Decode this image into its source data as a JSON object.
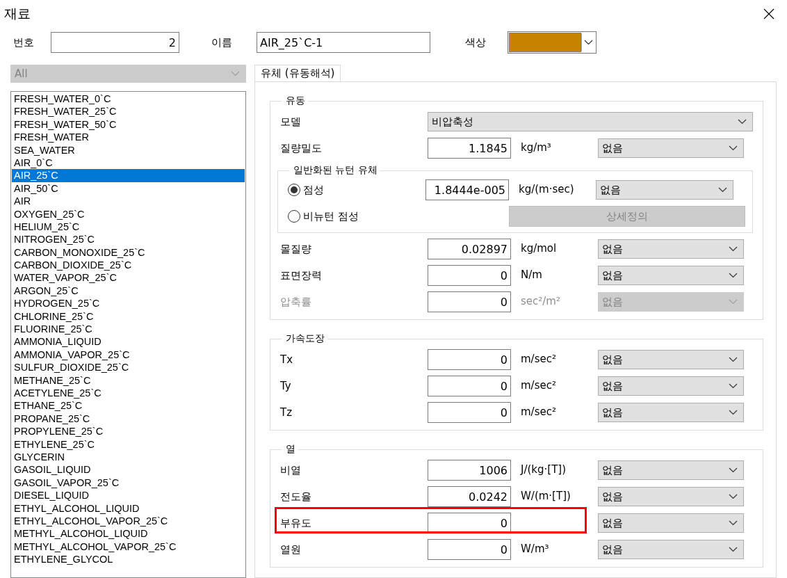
{
  "window": {
    "title": "재료"
  },
  "header": {
    "number_label": "번호",
    "number": "2",
    "name_label": "이름",
    "name": "AIR_25`C-1",
    "color_label": "색상",
    "color": "#c88200"
  },
  "filter": {
    "value": "All",
    "disabled": true
  },
  "materials": [
    {
      "label": "FRESH_WATER_0`C",
      "selected": false
    },
    {
      "label": "FRESH_WATER_25`C",
      "selected": false
    },
    {
      "label": "FRESH_WATER_50`C",
      "selected": false
    },
    {
      "label": "FRESH_WATER",
      "selected": false
    },
    {
      "label": "SEA_WATER",
      "selected": false
    },
    {
      "label": "AIR_0`C",
      "selected": false
    },
    {
      "label": "AIR_25`C",
      "selected": true
    },
    {
      "label": "AIR_50`C",
      "selected": false
    },
    {
      "label": "AIR",
      "selected": false
    },
    {
      "label": "OXYGEN_25`C",
      "selected": false
    },
    {
      "label": "HELIUM_25`C",
      "selected": false
    },
    {
      "label": "NITROGEN_25`C",
      "selected": false
    },
    {
      "label": "CARBON_MONOXIDE_25`C",
      "selected": false
    },
    {
      "label": "CARBON_DIOXIDE_25`C",
      "selected": false
    },
    {
      "label": "WATER_VAPOR_25`C",
      "selected": false
    },
    {
      "label": "ARGON_25`C",
      "selected": false
    },
    {
      "label": "HYDROGEN_25`C",
      "selected": false
    },
    {
      "label": "CHLORINE_25`C",
      "selected": false
    },
    {
      "label": "FLUORINE_25`C",
      "selected": false
    },
    {
      "label": "AMMONIA_LIQUID",
      "selected": false
    },
    {
      "label": "AMMONIA_VAPOR_25`C",
      "selected": false
    },
    {
      "label": "SULFUR_DIOXIDE_25`C",
      "selected": false
    },
    {
      "label": "METHANE_25`C",
      "selected": false
    },
    {
      "label": "ACETYLENE_25`C",
      "selected": false
    },
    {
      "label": "ETHANE_25`C",
      "selected": false
    },
    {
      "label": "PROPANE_25`C",
      "selected": false
    },
    {
      "label": "PROPYLENE_25`C",
      "selected": false
    },
    {
      "label": "ETHYLENE_25`C",
      "selected": false
    },
    {
      "label": "GLYCERIN",
      "selected": false
    },
    {
      "label": "GASOIL_LIQUID",
      "selected": false
    },
    {
      "label": "GASOIL_VAPOR_25`C",
      "selected": false
    },
    {
      "label": "DIESEL_LIQUID",
      "selected": false
    },
    {
      "label": "ETHYL_ALCOHOL_LIQUID",
      "selected": false
    },
    {
      "label": "ETHYL_ALCOHOL_VAPOR_25`C",
      "selected": false
    },
    {
      "label": "METHYL_ALCOHOL_LIQUID",
      "selected": false
    },
    {
      "label": "METHYL_ALCOHOL_VAPOR_25`C",
      "selected": false
    },
    {
      "label": "ETHYLENE_GLYCOL",
      "selected": false
    }
  ],
  "tabs": [
    {
      "label": "유체 (유동해석)",
      "selected": true
    }
  ],
  "groups": [
    {
      "title": "유동",
      "items": [
        {
          "kind": "select",
          "label": "모델",
          "value": "비압축성"
        },
        {
          "kind": "property",
          "label": "질량밀도",
          "value": "1.1845",
          "unit": "kg/m³",
          "option": "없음",
          "disabled": false,
          "highlighted": false
        },
        {
          "kind": "subgroup",
          "title": "일반화된 뉴턴 유체",
          "items": [
            {
              "kind": "radio",
              "label": "점성",
              "selected": true,
              "value": "1.8444e-005",
              "unit": "kg/(m·sec)",
              "option": "없음"
            },
            {
              "kind": "radio",
              "label": "비뉴턴 점성",
              "selected": false,
              "button": "상세정의",
              "button_disabled": true
            }
          ]
        },
        {
          "kind": "property",
          "label": "몰질량",
          "value": "0.02897",
          "unit": "kg/mol",
          "option": "없음",
          "disabled": false,
          "highlighted": false
        },
        {
          "kind": "property",
          "label": "표면장력",
          "value": "0",
          "unit": "N/m",
          "option": "없음",
          "disabled": false,
          "highlighted": false
        },
        {
          "kind": "property",
          "label": "압축률",
          "value": "0",
          "unit": "sec²/m²",
          "option": "없음",
          "disabled": true,
          "highlighted": false
        }
      ]
    },
    {
      "title": "가속도장",
      "items": [
        {
          "kind": "property",
          "label": "Tx",
          "value": "0",
          "unit": "m/sec²",
          "option": "없음",
          "disabled": false,
          "highlighted": false
        },
        {
          "kind": "property",
          "label": "Ty",
          "value": "0",
          "unit": "m/sec²",
          "option": "없음",
          "disabled": false,
          "highlighted": false
        },
        {
          "kind": "property",
          "label": "Tz",
          "value": "0",
          "unit": "m/sec²",
          "option": "없음",
          "disabled": false,
          "highlighted": false
        }
      ]
    },
    {
      "title": "열",
      "items": [
        {
          "kind": "property",
          "label": "비열",
          "value": "1006",
          "unit": "J/(kg·[T])",
          "option": "없음",
          "disabled": false,
          "highlighted": false
        },
        {
          "kind": "property",
          "label": "전도율",
          "value": "0.0242",
          "unit": "W/(m·[T])",
          "option": "없음",
          "disabled": false,
          "highlighted": false
        },
        {
          "kind": "property",
          "label": "부유도",
          "value": "0",
          "option": "없음",
          "disabled": false,
          "highlighted": true
        },
        {
          "kind": "property",
          "label": "열원",
          "value": "0",
          "unit": "W/m³",
          "option": "없음",
          "disabled": false,
          "highlighted": false
        }
      ]
    }
  ]
}
